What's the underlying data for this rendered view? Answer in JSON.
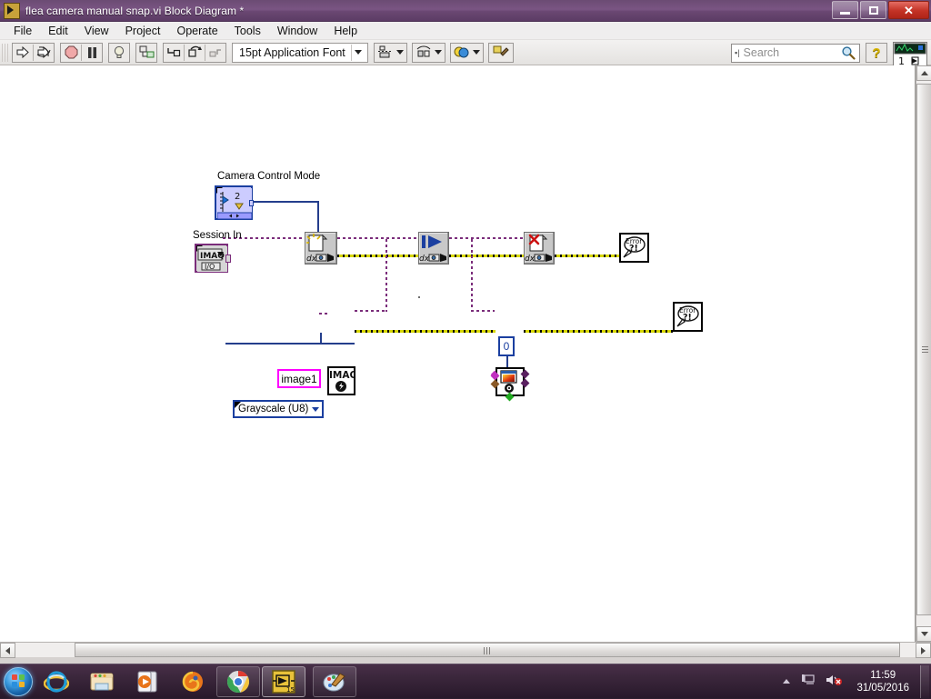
{
  "window": {
    "title": "flea camera manual snap.vi Block Diagram *",
    "app_icon": "labview-vi-icon",
    "buttons": {
      "minimize": "minimize-button",
      "maximize": "maximize-button",
      "close": "close-button",
      "close_label": "✕"
    }
  },
  "menu": {
    "items": [
      {
        "label": "File"
      },
      {
        "label": "Edit"
      },
      {
        "label": "View"
      },
      {
        "label": "Project"
      },
      {
        "label": "Operate"
      },
      {
        "label": "Tools"
      },
      {
        "label": "Window"
      },
      {
        "label": "Help"
      }
    ]
  },
  "toolbar": {
    "run_button": "run-arrow-icon",
    "run_continuously_button": "run-continuously-icon",
    "abort_button": "abort-execution-icon",
    "pause_button": "pause-icon",
    "highlight_execution_button": "lightbulb-icon",
    "retain_wire_values_button": "retain-wire-values-icon",
    "step_into_button": "step-into-icon",
    "step_over_button": "step-over-icon",
    "step_out_button": "step-out-icon",
    "font_selector": "15pt Application Font",
    "align_objects_button": "align-objects-icon",
    "distribute_objects_button": "distribute-objects-icon",
    "reorder_button": "reorder-icon",
    "clean_up_diagram_button": "clean-up-diagram-icon",
    "search": {
      "placeholder": "Search",
      "value": "",
      "icon": "magnifier-icon"
    },
    "help_button": "context-help-icon",
    "vi_icon": "vi-icon-pane"
  },
  "diagram": {
    "labels": {
      "camera_control_mode": "Camera Control Mode",
      "session_in": "Session In"
    },
    "controls": {
      "camera_control_mode_value": "2",
      "session_refnum_text": "IMAQ",
      "session_refnum_sub": "I/O",
      "image_name_value": "image1",
      "image_type_value": "Grayscale (U8)",
      "numeric_constant_value": "0"
    },
    "nodes": [
      {
        "name": "imaq-init-vi",
        "icon": "imaq-init-camera-icon"
      },
      {
        "name": "imaq-snap-vi",
        "icon": "imaq-snap-play-icon"
      },
      {
        "name": "imaq-close-vi",
        "icon": "imaq-close-camera-icon"
      },
      {
        "name": "imaq-create-vi",
        "icon": "imaq-create-image-icon"
      },
      {
        "name": "imaq-windraw-vi",
        "icon": "imaq-window-draw-icon"
      }
    ],
    "indicators": [
      {
        "name": "error-out-top",
        "label": "Error",
        "sub": "?!"
      },
      {
        "name": "error-out-bottom",
        "label": "Error",
        "sub": "?!"
      }
    ],
    "colors": {
      "error_wire": "#7b2d7b",
      "session_wire_dark": "#000000",
      "session_wire_light": "#d8d800",
      "blue_wire": "#243e8c",
      "enum_border": "#1b3fa0",
      "string_border": "#ff00ff",
      "refnum_border": "#7b2d7b"
    }
  },
  "scrollbars": {
    "vertical": "vertical-scrollbar",
    "horizontal": "horizontal-scrollbar"
  },
  "taskbar": {
    "start": "windows-start-orb",
    "items": [
      {
        "name": "taskbar-internet-explorer",
        "icon": "internet-explorer-icon"
      },
      {
        "name": "taskbar-windows-explorer",
        "icon": "folder-icon"
      },
      {
        "name": "taskbar-media-player",
        "icon": "media-player-icon"
      },
      {
        "name": "taskbar-firefox",
        "icon": "firefox-icon"
      },
      {
        "name": "taskbar-chrome",
        "icon": "chrome-icon"
      },
      {
        "name": "taskbar-labview",
        "icon": "labview-icon"
      },
      {
        "name": "taskbar-paint",
        "icon": "paint-icon"
      }
    ],
    "tray": {
      "show_hidden_icons": "chevron-up-icon",
      "network_icon": "network-icon",
      "volume_icon": "volume-muted-icon",
      "time": "11:59",
      "date": "31/05/2016"
    }
  }
}
